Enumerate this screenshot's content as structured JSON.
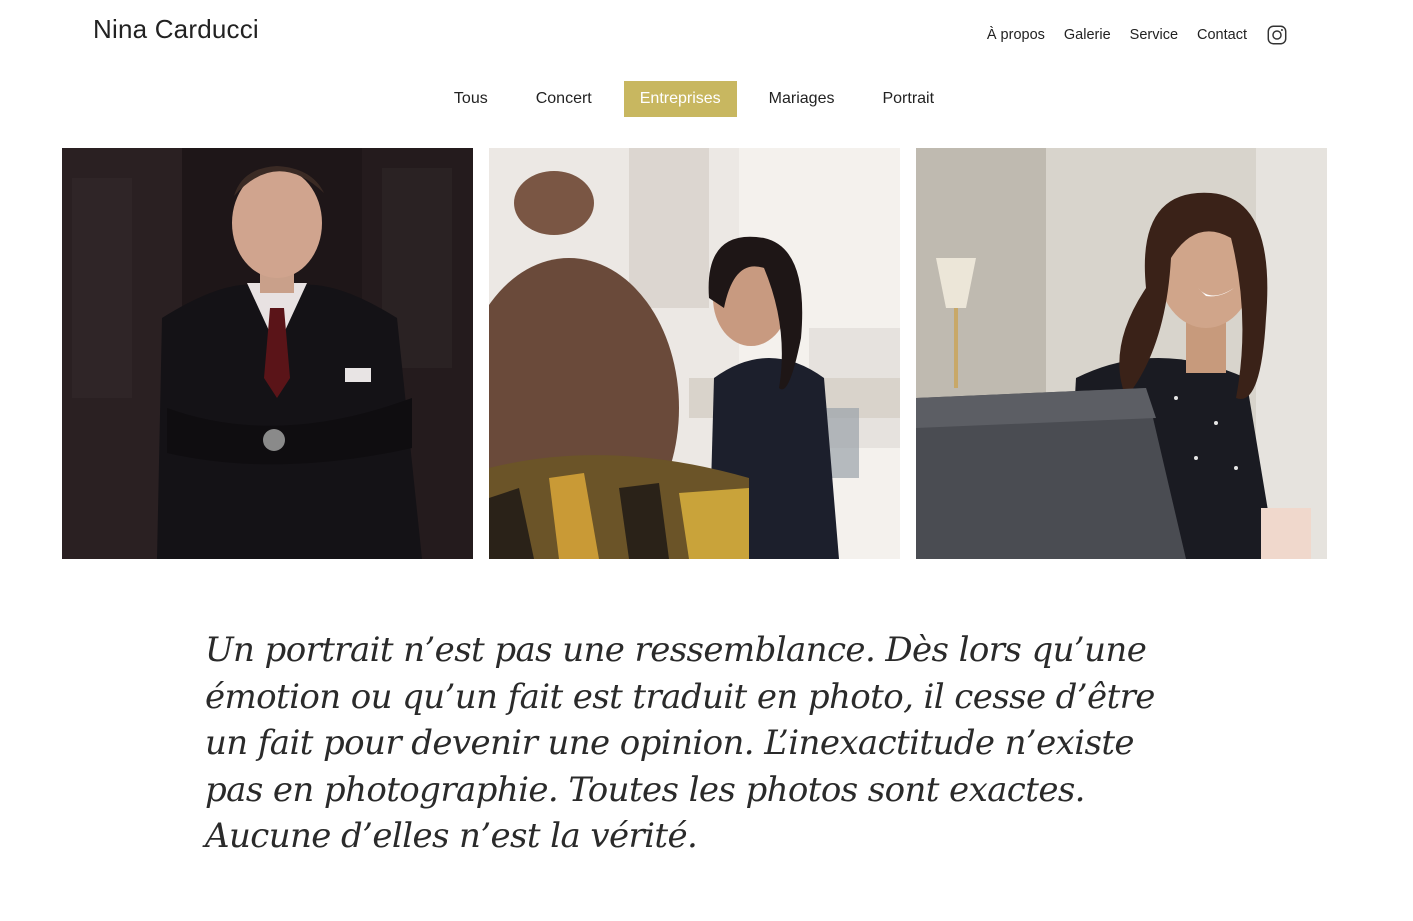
{
  "brand": {
    "name": "Nina Carducci"
  },
  "nav": {
    "items": [
      {
        "label": "À propos"
      },
      {
        "label": "Galerie"
      },
      {
        "label": "Service"
      },
      {
        "label": "Contact"
      }
    ],
    "social_icon": "instagram-icon"
  },
  "filters": {
    "items": [
      {
        "label": "Tous",
        "active": false
      },
      {
        "label": "Concert",
        "active": false
      },
      {
        "label": "Entreprises",
        "active": true
      },
      {
        "label": "Mariages",
        "active": false
      },
      {
        "label": "Portrait",
        "active": false
      }
    ],
    "active_color": "#c8b760"
  },
  "gallery": {
    "photos": [
      {
        "name": "photo-man-in-suit"
      },
      {
        "name": "photo-woman-meeting"
      },
      {
        "name": "photo-woman-laptop"
      }
    ]
  },
  "quote": {
    "text": "Un portrait n’est pas une ressemblance. Dès lors qu’une émotion ou qu’un fait est traduit en photo, il cesse d’être un fait pour devenir une opinion. L’inexactitude n’existe pas en photographie. Toutes les photos sont exactes. Aucune d’elles n’est la vérité."
  }
}
